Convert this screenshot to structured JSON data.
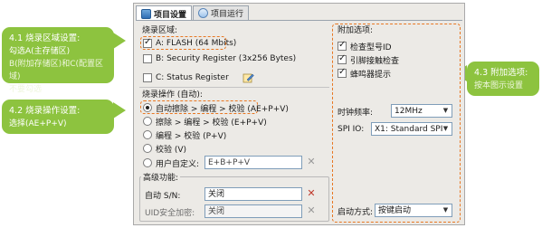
{
  "callouts": {
    "c41": {
      "title": "4.1 烧录区域设置:",
      "line1": "勾选A(主存储区)",
      "line2": "B(附加存储区)和C(配置区域)",
      "line3": "不要勾选"
    },
    "c42": {
      "title": "4.2 烧录操作设置:",
      "line1": "选择(AE+P+V)"
    },
    "c43": {
      "title": "4.3 附加选项:",
      "line1": "按本图示设置"
    }
  },
  "colors": {
    "callout_bg": "#8dc33f",
    "highlight_dash": "#e87722"
  },
  "tabs": [
    {
      "label": "项目设置",
      "active": true,
      "icon": "settings-icon"
    },
    {
      "label": "项目运行",
      "active": false,
      "icon": "run-icon"
    }
  ],
  "burn_area": {
    "label": "烧录区域:",
    "items": [
      {
        "label": "A: FLASH (64 Mbits)",
        "checked": true
      },
      {
        "label": "B: Security Register (3x256 Bytes)",
        "checked": false
      },
      {
        "label": "C: Status Register",
        "checked": false,
        "icon": "edit-icon"
      }
    ]
  },
  "burn_op": {
    "label": "烧录操作 (自动):",
    "options": [
      {
        "label": "自动擦除 > 编程 > 校验 (AE+P+V)",
        "selected": true
      },
      {
        "label": "擦除 > 编程 > 校验 (E+P+V)",
        "selected": false
      },
      {
        "label": "编程 > 校验 (P+V)",
        "selected": false
      },
      {
        "label": "校验 (V)",
        "selected": false
      },
      {
        "label": "用户自定义:",
        "selected": false,
        "value": "E+B+P+V"
      }
    ]
  },
  "advanced": {
    "label": "高级功能:",
    "auto_sn_label": "自动 S/N:",
    "auto_sn_value": "关闭",
    "uid_label": "UID安全加密:",
    "uid_value": "关闭"
  },
  "extra": {
    "label": "附加选项:",
    "checks": [
      {
        "label": "检查型号ID",
        "checked": true
      },
      {
        "label": "引脚接触检查",
        "checked": true
      },
      {
        "label": "蜂鸣器提示",
        "checked": true
      }
    ],
    "clock_label": "时钟频率:",
    "clock_value": "12MHz",
    "spi_label": "SPI IO:",
    "spi_value": "X1: Standard SPI",
    "start_label": "启动方式:",
    "start_value": "按键启动"
  }
}
